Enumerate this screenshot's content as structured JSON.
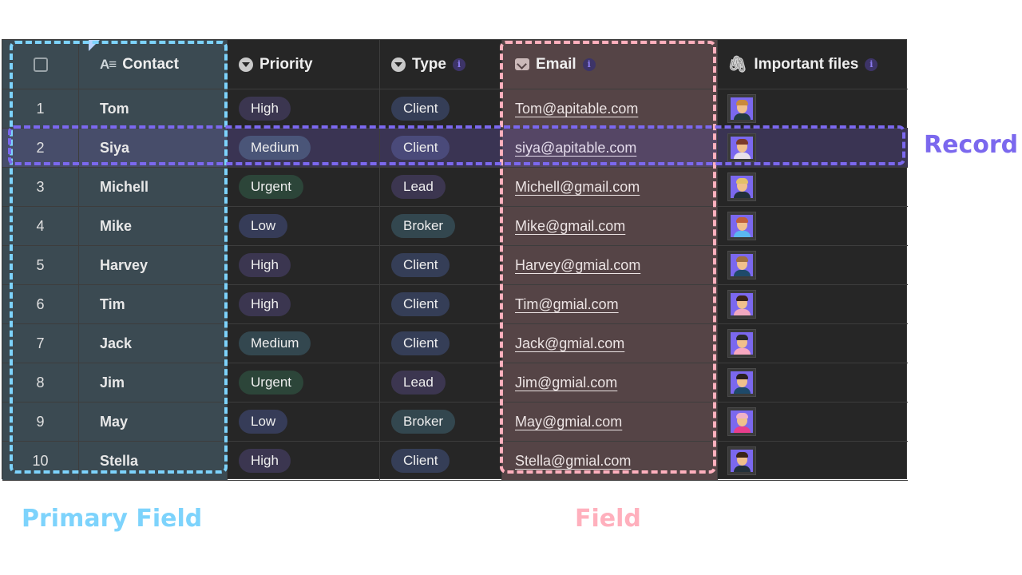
{
  "columns": [
    {
      "key": "contact",
      "label": "Contact",
      "icon": "text-field-icon",
      "primary": true
    },
    {
      "key": "priority",
      "label": "Priority",
      "icon": "single-select-icon",
      "info": false
    },
    {
      "key": "type",
      "label": "Type",
      "icon": "single-select-icon",
      "info": true
    },
    {
      "key": "email",
      "label": "Email",
      "icon": "email-icon",
      "info": true
    },
    {
      "key": "files",
      "label": "Important files",
      "icon": "attachment-icon",
      "info": true
    }
  ],
  "info_glyph": "i",
  "text_icon_glyph": "A≡",
  "clip_glyph": "✐",
  "rows": [
    {
      "num": "1",
      "contact": "Tom",
      "priority": "High",
      "type": "Client",
      "email": "Tom@apitable.com",
      "avatar": {
        "hair": "#c98a3c",
        "body": "#233a40"
      }
    },
    {
      "num": "2",
      "contact": "Siya",
      "priority": "Medium",
      "type": "Client",
      "email": "siya@apitable.com",
      "avatar": {
        "hair": "#7a3a2a",
        "body": "#e8e0ea"
      },
      "selected": true
    },
    {
      "num": "3",
      "contact": "Michell",
      "priority": "Urgent",
      "type": "Lead",
      "email": "Michell@gmail.com",
      "avatar": {
        "hair": "#e2c06a",
        "body": "#22303a"
      }
    },
    {
      "num": "4",
      "contact": "Mike",
      "priority": "Low",
      "type": "Broker",
      "email": "Mike@gmail.com",
      "avatar": {
        "hair": "#c0603a",
        "body": "#5bb8f0"
      }
    },
    {
      "num": "5",
      "contact": "Harvey",
      "priority": "High",
      "type": "Client",
      "email": "Harvey@gmial.com",
      "avatar": {
        "hair": "#a07040",
        "body": "#1e4a6a"
      }
    },
    {
      "num": "6",
      "contact": "Tim",
      "priority": "High",
      "type": "Client",
      "email": "Tim@gmial.com",
      "avatar": {
        "hair": "#3a2418",
        "body": "#f0a8c0"
      }
    },
    {
      "num": "7",
      "contact": "Jack",
      "priority": "Medium",
      "type": "Client",
      "email": "Jack@gmial.com",
      "avatar": {
        "hair": "#2a2a2a",
        "body": "#f7a8c0"
      }
    },
    {
      "num": "8",
      "contact": "Jim",
      "priority": "Urgent",
      "type": "Lead",
      "email": "Jim@gmial.com",
      "avatar": {
        "hair": "#2a2020",
        "body": "#1e4a6a"
      }
    },
    {
      "num": "9",
      "contact": "May",
      "priority": "Low",
      "type": "Broker",
      "email": "May@gmial.com",
      "avatar": {
        "hair": "#f0b0c8",
        "body": "#e83e8c"
      }
    },
    {
      "num": "10",
      "contact": "Stella",
      "priority": "High",
      "type": "Client",
      "email": "Stella@gmial.com",
      "avatar": {
        "hair": "#3a2418",
        "body": "#22303a"
      }
    }
  ],
  "annotations": {
    "primary_field": "Primary Field",
    "field": "Field",
    "record": "Record"
  },
  "colors": {
    "primary_field_accent": "#7dd3fc",
    "field_accent": "#ffb0bd",
    "record_accent": "#7b68ee"
  }
}
